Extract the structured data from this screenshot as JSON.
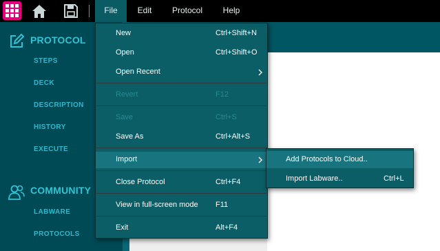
{
  "colors": {
    "topbar": "#000000",
    "apps_button": "#e6007e",
    "sidebar": "#004a55",
    "section_title": "#33c2d3",
    "nav_item": "#2fb8cb",
    "menu_bg": "#0b5d66",
    "menu_highlight": "#187580",
    "menu_disabled": "#2b8a93"
  },
  "topbar": {
    "icons": [
      "apps-grid-icon",
      "home-icon",
      "save-icon"
    ],
    "menus": [
      {
        "label": "File",
        "active": true
      },
      {
        "label": "Edit"
      },
      {
        "label": "Protocol"
      },
      {
        "label": "Help"
      }
    ]
  },
  "sidebar": {
    "protocol": {
      "title": "PROTOCOL",
      "icon": "edit-icon",
      "items": [
        "STEPS",
        "DECK",
        "DESCRIPTION",
        "HISTORY",
        "EXECUTE"
      ]
    },
    "community": {
      "title": "COMMUNITY",
      "icon": "users-icon",
      "items": [
        "LABWARE",
        "PROTOCOLS"
      ]
    }
  },
  "file_menu": {
    "items": [
      {
        "label": "New",
        "shortcut": "Ctrl+Shift+N"
      },
      {
        "label": "Open",
        "shortcut": "Ctrl+Shift+O"
      },
      {
        "label": "Open Recent",
        "shortcut": "",
        "submenu": true
      },
      {
        "label": "Revert",
        "shortcut": "F12",
        "disabled": true
      },
      {
        "label": "Save",
        "shortcut": "Ctrl+S",
        "disabled": true
      },
      {
        "label": "Save As",
        "shortcut": "Ctrl+Alt+S"
      },
      {
        "label": "Import",
        "shortcut": "",
        "submenu": true,
        "highlighted": true
      },
      {
        "label": "Close Protocol",
        "shortcut": "Ctrl+F4"
      },
      {
        "label": "View in full-screen mode",
        "shortcut": "F11"
      },
      {
        "label": "Exit",
        "shortcut": "Alt+F4"
      }
    ]
  },
  "import_submenu": {
    "items": [
      {
        "label": "Add Protocols to Cloud..",
        "shortcut": "",
        "highlighted": true
      },
      {
        "label": "Import Labware..",
        "shortcut": "Ctrl+L"
      }
    ]
  }
}
